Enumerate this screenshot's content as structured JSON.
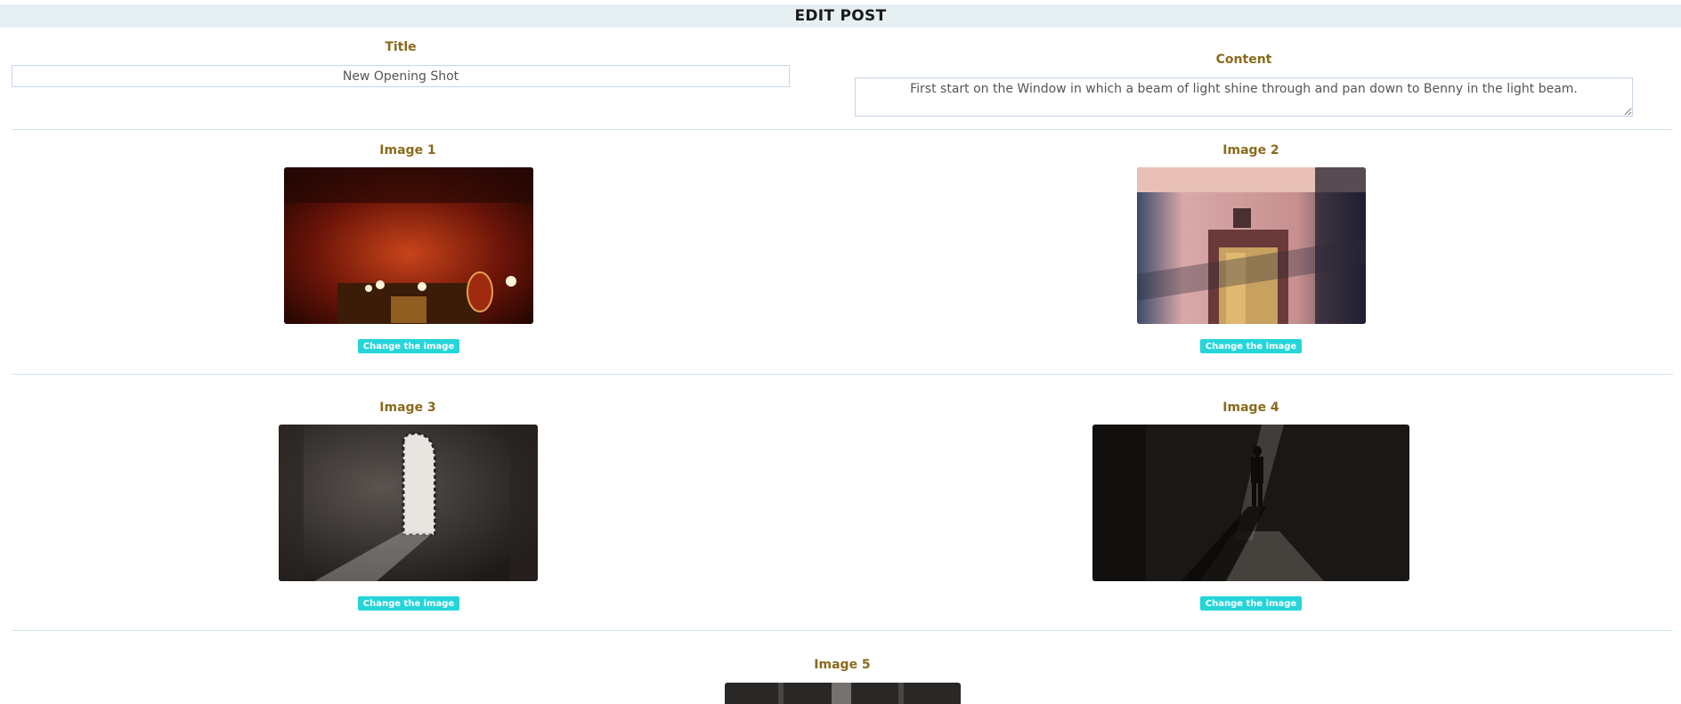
{
  "page": {
    "title": "EDIT POST"
  },
  "form": {
    "title_label": "Title",
    "title_value": "New Opening Shot",
    "content_label": "Content",
    "content_value": "First start on the Window in which a beam of light shine through and pan down to Benny in the light beam."
  },
  "images": [
    {
      "label": "Image 1",
      "button": "Change the image"
    },
    {
      "label": "Image 2",
      "button": "Change the image"
    },
    {
      "label": "Image 3",
      "button": "Change the image"
    },
    {
      "label": "Image 4",
      "button": "Change the image"
    },
    {
      "label": "Image 5"
    }
  ],
  "colors": {
    "label": "#8a6a1c",
    "button": "#25d5d9",
    "topbar": "#e6eff1"
  }
}
